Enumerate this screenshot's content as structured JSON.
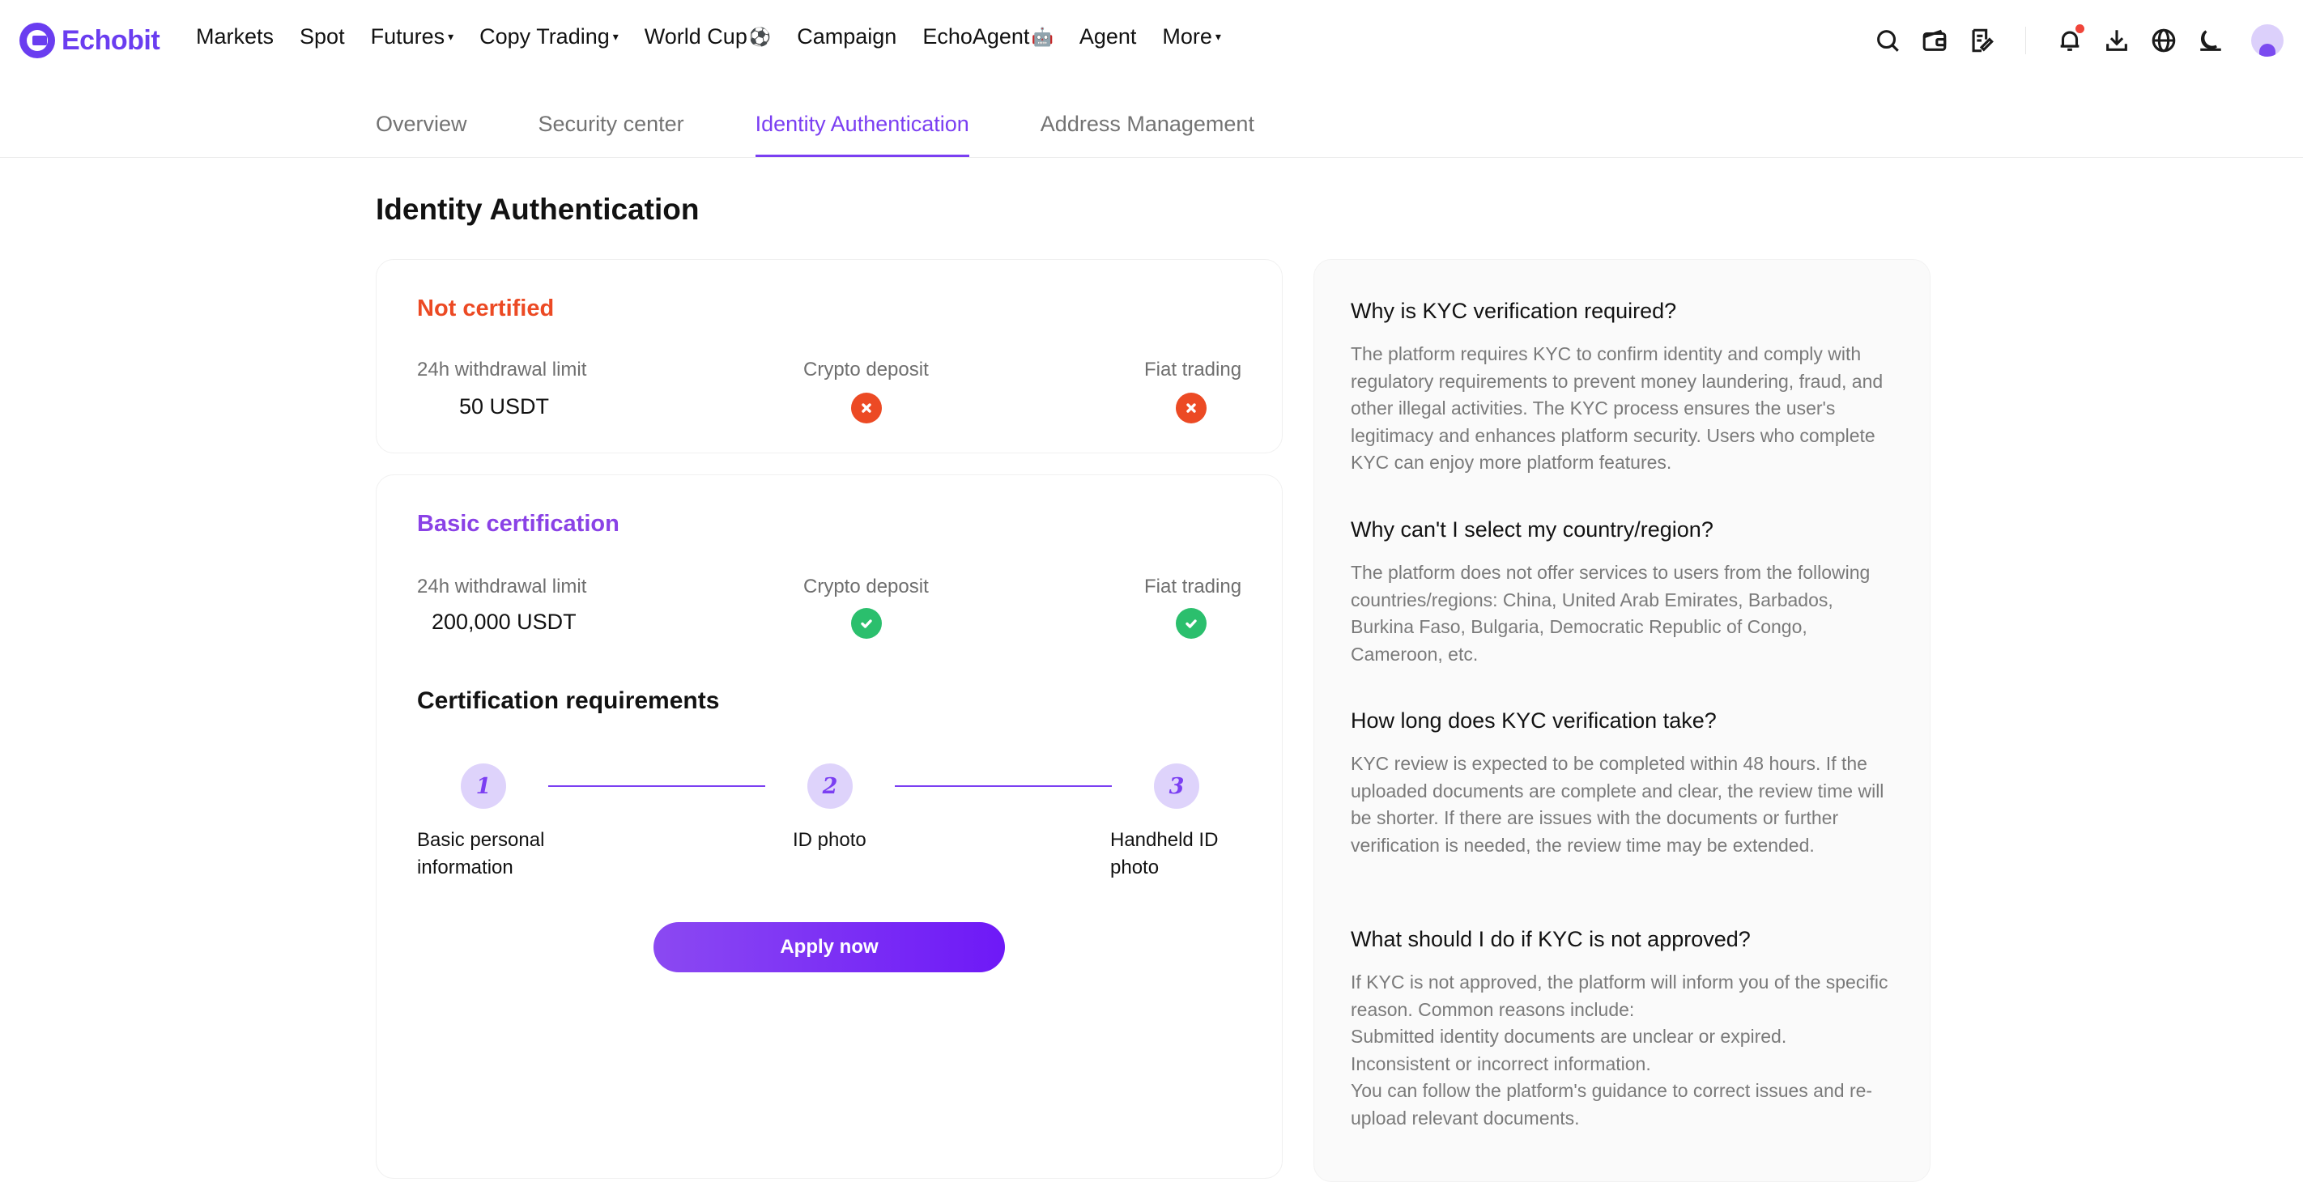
{
  "brand": {
    "name": "Echobit"
  },
  "nav": {
    "items": [
      {
        "label": "Markets",
        "caret": false,
        "emoji": ""
      },
      {
        "label": "Spot",
        "caret": false,
        "emoji": ""
      },
      {
        "label": "Futures",
        "caret": true,
        "emoji": ""
      },
      {
        "label": "Copy Trading",
        "caret": true,
        "emoji": ""
      },
      {
        "label": "World Cup",
        "caret": false,
        "emoji": "⚽"
      },
      {
        "label": "Campaign",
        "caret": false,
        "emoji": ""
      },
      {
        "label": "EchoAgent",
        "caret": false,
        "emoji": "🤖"
      },
      {
        "label": "Agent",
        "caret": false,
        "emoji": ""
      },
      {
        "label": "More",
        "caret": true,
        "emoji": ""
      }
    ],
    "icons": [
      "search-icon",
      "wallet-icon",
      "orders-icon",
      "bell-icon",
      "download-icon",
      "globe-icon",
      "theme-icon",
      "avatar"
    ]
  },
  "tabs": [
    {
      "label": "Overview",
      "active": false
    },
    {
      "label": "Security center",
      "active": false
    },
    {
      "label": "Identity Authentication",
      "active": true
    },
    {
      "label": "Address Management",
      "active": false
    }
  ],
  "page": {
    "title": "Identity Authentication"
  },
  "levels": {
    "not_certified": {
      "title": "Not certified",
      "withdraw_label": "24h withdrawal limit",
      "withdraw_value": "50 USDT",
      "crypto_label": "Crypto deposit",
      "crypto_enabled": false,
      "fiat_label": "Fiat trading",
      "fiat_enabled": false
    },
    "basic": {
      "title": "Basic certification",
      "withdraw_label": "24h withdrawal limit",
      "withdraw_value": "200,000 USDT",
      "crypto_label": "Crypto deposit",
      "crypto_enabled": true,
      "fiat_label": "Fiat trading",
      "fiat_enabled": true,
      "requirements_title": "Certification requirements",
      "steps": [
        {
          "num": "1",
          "label": "Basic personal information"
        },
        {
          "num": "2",
          "label": "ID photo"
        },
        {
          "num": "3",
          "label": "Handheld ID photo"
        }
      ],
      "apply_label": "Apply now"
    }
  },
  "faq": [
    {
      "q": "Why is KYC verification required?",
      "a": "The platform requires KYC to confirm identity and comply with regulatory requirements to prevent money laundering, fraud, and other illegal activities. The KYC process ensures the user's legitimacy and enhances platform security. Users who complete KYC can enjoy more platform features."
    },
    {
      "q": "Why can't I select my country/region?",
      "a": "The platform does not offer services to users from the following countries/regions: China, United Arab Emirates, Barbados, Burkina Faso, Bulgaria, Democratic Republic of Congo, Cameroon, etc."
    },
    {
      "q": "How long does KYC verification take?",
      "a": "KYC review is expected to be completed within 48 hours. If the uploaded documents are complete and clear, the review time will be shorter. If there are issues with the documents or further verification is needed, the review time may be extended."
    },
    {
      "q": "What should I do if KYC is not approved?",
      "a": "If KYC is not approved, the platform will inform you of the specific reason. Common reasons include:\nSubmitted identity documents are unclear or expired.\nInconsistent or incorrect information.\nYou can follow the platform's guidance to correct issues and re-upload relevant documents."
    }
  ],
  "colors": {
    "accent": "#7b3ff2",
    "brand": "#6a3df0",
    "error": "#ec4a24",
    "success": "#2bbf6d"
  }
}
